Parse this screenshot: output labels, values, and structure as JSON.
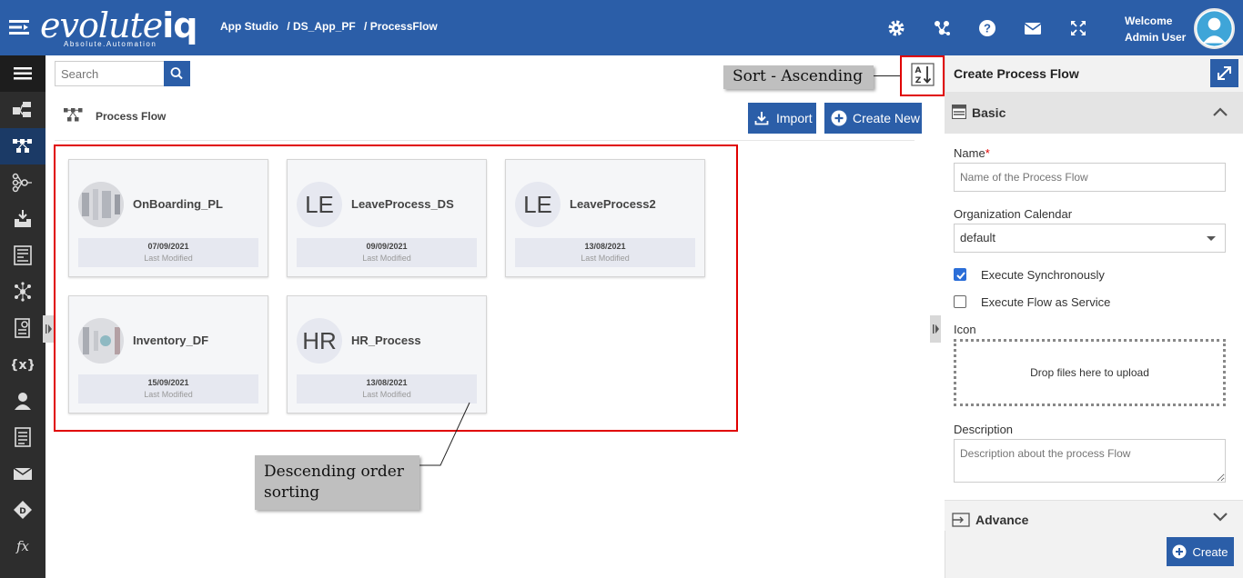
{
  "colors": {
    "brand": "#2b5ea8",
    "rail": "#2d2d2d",
    "annotation_border": "#e00000"
  },
  "header": {
    "logo_text": "evolute",
    "logo_iq": "iq",
    "logo_tagline": "Absolute.Automation",
    "breadcrumb": [
      "App Studio",
      "/ DS_App_PF",
      "/ ProcessFlow"
    ],
    "welcome_line1": "Welcome",
    "welcome_line2": "Admin User",
    "icons": [
      "gear-icon",
      "network-icon",
      "help-icon",
      "mail-icon",
      "fullscreen-icon"
    ]
  },
  "sidebar": {
    "items": [
      "menu-icon",
      "hierarchy-icon",
      "process-flow-icon",
      "decision-flow-icon",
      "inbox-icon",
      "form-icon",
      "integration-icon",
      "report-icon",
      "variable-icon",
      "user-icon",
      "document-icon",
      "mail-icon",
      "decision-icon",
      "function-icon"
    ],
    "variable_glyph": "{x}",
    "function_glyph": "fx",
    "decision_glyph": "D"
  },
  "search": {
    "placeholder": "Search"
  },
  "main": {
    "title": "Process Flow",
    "import_label": "Import",
    "create_new_label": "Create New",
    "cards": [
      {
        "name": "OnBoarding_PL",
        "thumb": "",
        "date": "07/09/2021",
        "modified_label": "Last Modified"
      },
      {
        "name": "LeaveProcess_DS",
        "thumb": "LE",
        "date": "09/09/2021",
        "modified_label": "Last Modified"
      },
      {
        "name": "LeaveProcess2",
        "thumb": "LE",
        "date": "13/08/2021",
        "modified_label": "Last Modified"
      },
      {
        "name": "Inventory_DF",
        "thumb": "",
        "date": "15/09/2021",
        "modified_label": "Last Modified"
      },
      {
        "name": "HR_Process",
        "thumb": "HR",
        "date": "13/08/2021",
        "modified_label": "Last Modified"
      }
    ]
  },
  "annotations": {
    "sort_label": "Sort - Ascending",
    "desc_line1": "Descending order",
    "desc_line2": "sorting"
  },
  "panel": {
    "title": "Create Process Flow",
    "basic_label": "Basic",
    "name_label": "Name",
    "required_mark": "*",
    "name_placeholder": "Name of the Process Flow",
    "calendar_label": "Organization Calendar",
    "calendar_value": "default",
    "exec_sync_label": "Execute Synchronously",
    "exec_sync_checked": true,
    "exec_service_label": "Execute Flow as Service",
    "exec_service_checked": false,
    "icon_label": "Icon",
    "dropzone_text": "Drop files here to upload",
    "description_label": "Description",
    "description_placeholder": "Description about the process Flow",
    "advance_label": "Advance",
    "create_label": "Create"
  }
}
